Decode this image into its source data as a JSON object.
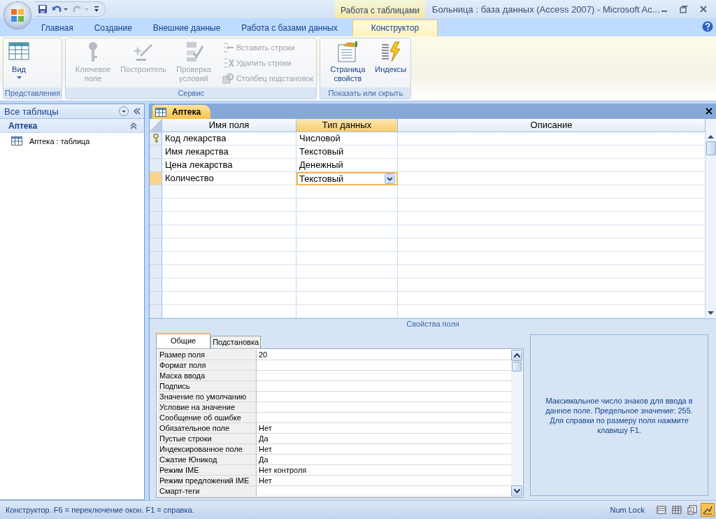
{
  "window": {
    "context_tab": "Работа с таблицами",
    "title": "Больница : база данных (Access 2007) - Microsoft Ac..."
  },
  "tabs": [
    {
      "label": "Главная",
      "selected": false
    },
    {
      "label": "Создание",
      "selected": false
    },
    {
      "label": "Внешние данные",
      "selected": false
    },
    {
      "label": "Работа с базами данных",
      "selected": false
    },
    {
      "label": "Конструктор",
      "selected": true
    }
  ],
  "ribbon_groups": [
    {
      "label": "Представления",
      "buttons": [
        {
          "kind": "view",
          "label": "Вид",
          "disabled": false
        }
      ]
    },
    {
      "label": "Сервис",
      "buttons": [
        {
          "kind": "key",
          "label": "Ключевое поле",
          "disabled": true
        },
        {
          "kind": "builder",
          "label": "Построитель",
          "disabled": true
        },
        {
          "kind": "validation",
          "label": "Проверка условий",
          "disabled": true
        },
        {
          "kind": "insert_rows",
          "label": "Вставить строки",
          "disabled": true
        },
        {
          "kind": "delete_rows",
          "label": "Удалить строки",
          "disabled": true
        },
        {
          "kind": "lookup",
          "label": "Столбец  подстановок",
          "disabled": true
        }
      ]
    },
    {
      "label": "Показать или скрыть",
      "buttons": [
        {
          "kind": "property_sheet",
          "label": "Страница свойств",
          "disabled": false
        },
        {
          "kind": "indexes",
          "label": "Индексы",
          "disabled": false
        }
      ]
    }
  ],
  "nav_pane": {
    "title": "Все таблицы",
    "groups": [
      {
        "label": "Аптека",
        "items": [
          {
            "label": "Аптека : таблица"
          }
        ]
      }
    ]
  },
  "document_tab": {
    "label": "Аптека"
  },
  "design_grid": {
    "columns": [
      {
        "label": "Имя поля",
        "selected": false
      },
      {
        "label": "Тип данных",
        "selected": true
      },
      {
        "label": "Описание",
        "selected": false
      }
    ],
    "rows": [
      {
        "name": "Код лекарства",
        "type": "Числовой",
        "primary_key": true,
        "selected": false
      },
      {
        "name": "Имя лекарства",
        "type": "Текстовый",
        "primary_key": false,
        "selected": false
      },
      {
        "name": "Цена лекарства",
        "type": "Денежный",
        "primary_key": false,
        "selected": false
      },
      {
        "name": "Количество",
        "type": "Текстовый",
        "primary_key": false,
        "selected": true
      }
    ]
  },
  "field_properties": {
    "title": "Свойства поля",
    "tabs": [
      {
        "label": "Общие",
        "selected": true
      },
      {
        "label": "Подстановка",
        "selected": false
      }
    ],
    "rows": [
      {
        "label": "Размер поля",
        "value": "20"
      },
      {
        "label": "Формат поля"
      },
      {
        "label": "Маска ввода"
      },
      {
        "label": "Подпись"
      },
      {
        "label": "Значение по умолчанию"
      },
      {
        "label": "Условие на значение"
      },
      {
        "label": "Сообщение об ошибке"
      },
      {
        "label": "Обязательное поле",
        "value": "Нет"
      },
      {
        "label": "Пустые строки",
        "value": "Да"
      },
      {
        "label": "Индексированное поле",
        "value": "Нет"
      },
      {
        "label": "Сжатие Юникод",
        "value": "Да"
      },
      {
        "label": "Режим IME",
        "value": "Нет контроля"
      },
      {
        "label": "Режим предложений IME",
        "value": "Нет"
      },
      {
        "label": "Смарт-теги"
      }
    ],
    "help": "Максимальное число знаков для ввода в данное поле.  Предельное значение: 255.  Для справки по размеру поля нажмите клавишу F1."
  },
  "status_bar": {
    "text": "Конструктор.  F6 = переключение окон.  F1 = справка.",
    "indicator": "Num Lock",
    "view_buttons": [
      {
        "selected": false
      },
      {
        "selected": false
      },
      {
        "selected": false
      },
      {
        "selected": true
      }
    ]
  }
}
